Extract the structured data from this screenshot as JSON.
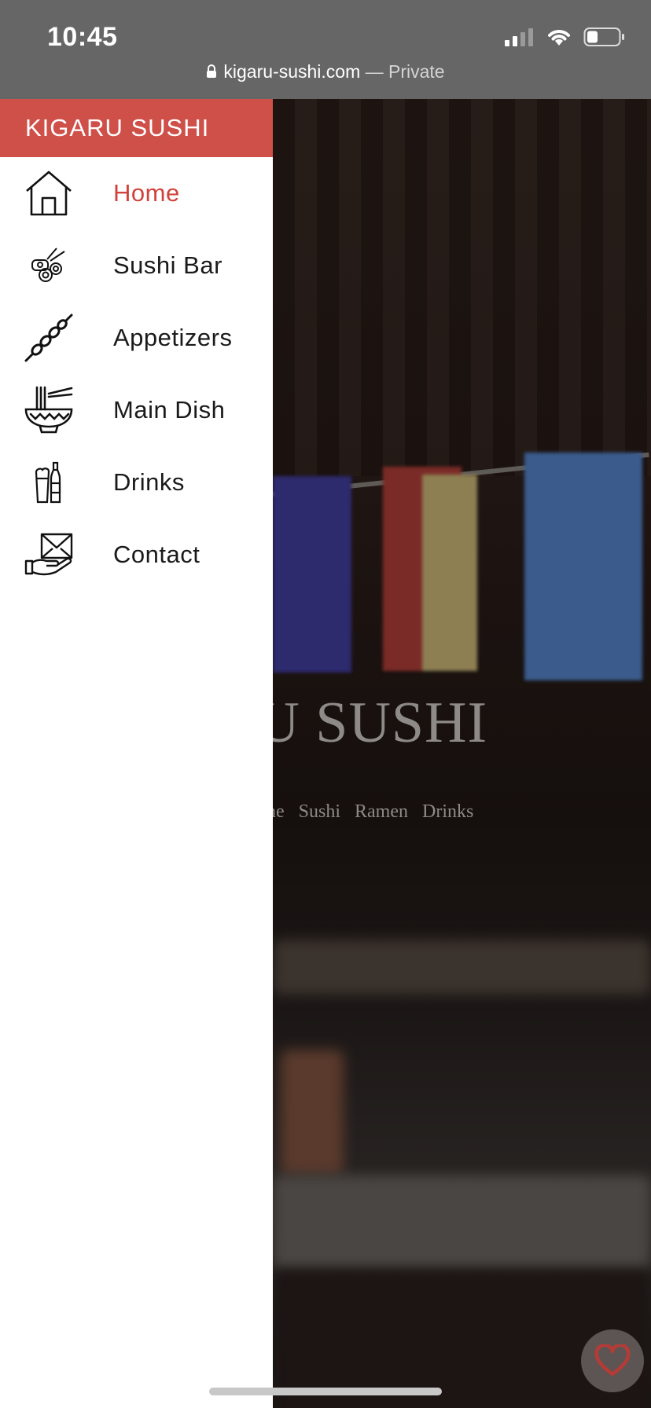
{
  "status_bar": {
    "time": "10:45",
    "url": "kigaru-sushi.com",
    "url_separator": " — ",
    "private_label": "Private"
  },
  "drawer": {
    "brand": "KIGARU SUSHI",
    "items": [
      {
        "label": "Home",
        "icon": "house-icon",
        "active": true
      },
      {
        "label": "Sushi Bar",
        "icon": "sushi-roll-icon"
      },
      {
        "label": "Appetizers",
        "icon": "skewer-icon"
      },
      {
        "label": "Main Dish",
        "icon": "ramen-bowl-icon"
      },
      {
        "label": "Drinks",
        "icon": "drinks-icon"
      },
      {
        "label": "Contact",
        "icon": "mail-hand-icon"
      }
    ]
  },
  "hero": {
    "title_partial": "RU SUSHI",
    "nav": [
      "ne",
      "Sushi",
      "Ramen",
      "Drinks"
    ]
  },
  "colors": {
    "brand_red": "#cf4f49",
    "active_text": "#d0433b",
    "status_bar_bg": "#666666"
  }
}
